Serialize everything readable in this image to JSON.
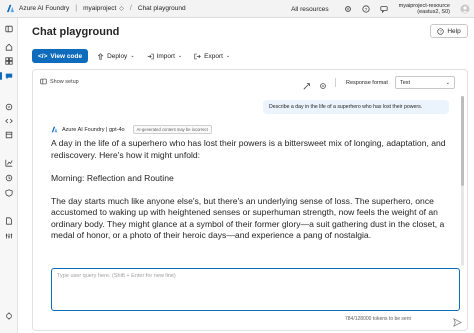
{
  "topbar": {
    "app_name": "Azure AI Foundry",
    "project": "myaiproject",
    "page": "Chat playground",
    "all_resources": "All resources",
    "account_line1": "myaiproject-resource",
    "account_line2": "(eastus2, S0)"
  },
  "header": {
    "title": "Chat playground",
    "help_label": "Help"
  },
  "toolbar": {
    "view_code": "View code",
    "deploy": "Deploy",
    "import": "Import",
    "export": "Export"
  },
  "chat": {
    "show_setup": "Show setup",
    "response_format_label": "Response format",
    "response_format_value": "Text",
    "user_message": "Describe a day in the life of a superhero who has lost their powers.",
    "assistant_name": "Azure AI Foundry | gpt-4o",
    "ai_badge": "AI-generated content may be incorrect",
    "response_paragraphs": [
      "A day in the life of a superhero who has lost their powers is a bittersweet mix of longing, adaptation, and rediscovery. Here's how it might unfold:",
      "Morning: Reflection and Routine",
      "The day starts much like anyone else's, but there's an underlying sense of loss. The superhero, once accustomed to waking up with heightened senses or superhuman strength, now feels the weight of an ordinary body. They might glance at a symbol of their former glory—a suit gathering dust in the closet, a medal of honor, or a photo of their heroic days—and experience a pang of nostalgia."
    ],
    "input_placeholder": "Type user query here. (Shift + Enter for new line)",
    "token_count": "784/128000 tokens to be sent"
  },
  "colors": {
    "accent": "#0f6cbd",
    "user_bubble": "#ebf3fc"
  }
}
